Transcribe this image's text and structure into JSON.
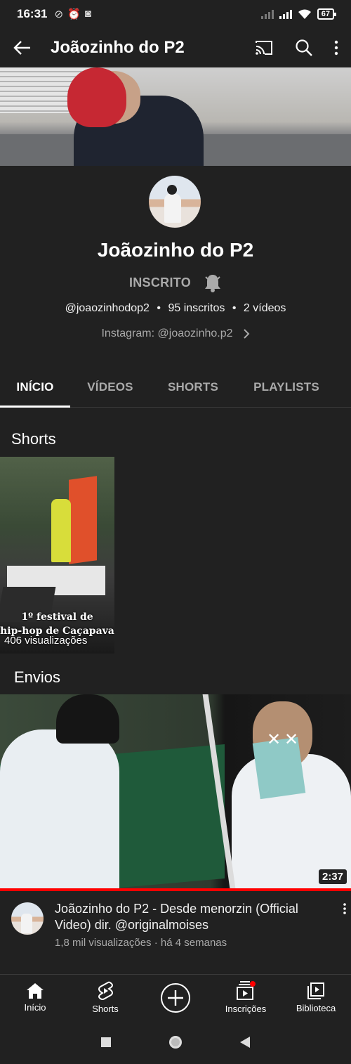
{
  "status_bar": {
    "time": "16:31",
    "battery": "67"
  },
  "app_bar": {
    "title": "Joãozinho do P2"
  },
  "channel": {
    "name": "Joãozinho do P2",
    "subscribed_label": "INSCRITO",
    "handle": "@joaozinhodop2",
    "subscribers": "95 inscritos",
    "videos": "2 vídeos",
    "separator": "•",
    "link": "Instagram: @joaozinho.p2"
  },
  "tabs": [
    {
      "label": "INÍCIO",
      "active": true
    },
    {
      "label": "VÍDEOS",
      "active": false
    },
    {
      "label": "SHORTS",
      "active": false
    },
    {
      "label": "PLAYLISTS",
      "active": false
    }
  ],
  "shorts_section": {
    "title": "Shorts",
    "items": [
      {
        "caption_line1": "1º festival de",
        "caption_line2": "hip-hop de Caçapava",
        "views": "406 visualizações"
      }
    ]
  },
  "uploads_section": {
    "title": "Envios",
    "items": [
      {
        "title": "Joãozinho do P2 - Desde menorzin (Official Video) dir. @originalmoises",
        "views": "1,8 mil visualizações",
        "age": "há 4 semanas",
        "meta_separator": "·",
        "duration": "2:37"
      }
    ]
  },
  "bottom_nav": [
    {
      "label": "Início",
      "icon": "home-icon"
    },
    {
      "label": "Shorts",
      "icon": "shorts-icon"
    },
    {
      "label": "",
      "icon": "create-icon"
    },
    {
      "label": "Inscrições",
      "icon": "subscriptions-icon"
    },
    {
      "label": "Biblioteca",
      "icon": "library-icon"
    }
  ],
  "colors": {
    "background": "#212121",
    "accent_red": "#ff0000",
    "secondary_text": "#aaaaaa"
  }
}
